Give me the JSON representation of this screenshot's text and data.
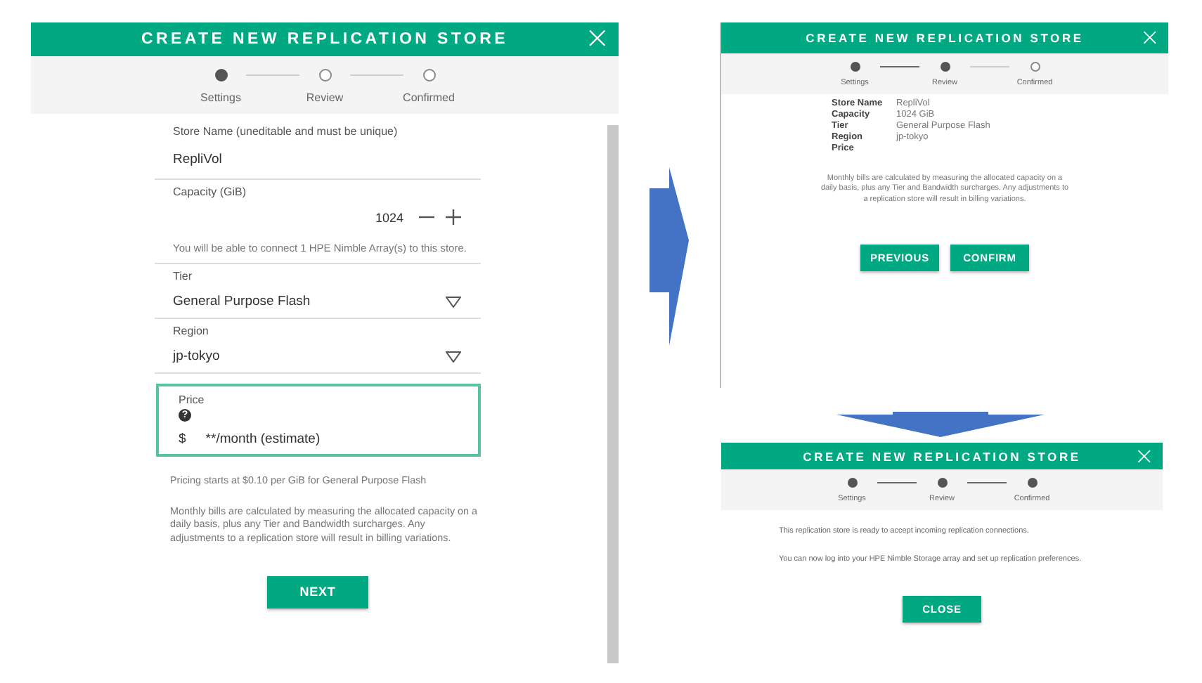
{
  "panels": [
    {
      "kind": "settings",
      "title": "CREATE NEW REPLICATION STORE",
      "close": "×",
      "steps": [
        {
          "label": "Settings",
          "completed": true
        },
        {
          "label": "Review",
          "completed": false
        },
        {
          "label": "Confirmed",
          "completed": false
        }
      ],
      "fields": [
        {
          "kind": "text",
          "label": "Store Name (uneditable and must be unique)",
          "value": "RepliVol"
        },
        {
          "kind": "stepper",
          "label": "Capacity (GiB)",
          "value": "1024",
          "note": "You will be able to connect 1 HPE Nimble Array(s) to this store."
        },
        {
          "kind": "select",
          "label": "Tier",
          "value": "General Purpose Flash"
        },
        {
          "kind": "select",
          "label": "Region",
          "value": "jp-tokyo"
        },
        {
          "kind": "price",
          "label": "Price",
          "help": "?",
          "currency": "$",
          "value": "**/month (estimate)"
        }
      ],
      "notes": [
        "Pricing starts at $0.10 per GiB for General Purpose Flash",
        "Monthly bills are calculated by measuring the allocated capacity on a daily basis, plus any Tier and Bandwidth surcharges. Any adjustments to a replication store will result in billing variations."
      ],
      "buttons": [
        "NEXT"
      ]
    },
    {
      "kind": "review",
      "title": "CREATE NEW REPLICATION STORE",
      "close": "×",
      "steps": [
        {
          "label": "Settings",
          "completed": true
        },
        {
          "label": "Review",
          "completed": true
        },
        {
          "label": "Confirmed",
          "completed": false
        }
      ],
      "summary": [
        {
          "label": "Store Name",
          "value": "RepliVol"
        },
        {
          "label": "Capacity",
          "value": "1024 GiB"
        },
        {
          "label": "Tier",
          "value": "General Purpose Flash"
        },
        {
          "label": "Region",
          "value": "jp-tokyo"
        },
        {
          "label": "Price"
        }
      ],
      "notes": [
        "Monthly bills are calculated by measuring the allocated capacity on a daily basis, plus any Tier and Bandwidth surcharges. Any adjustments to a replication store will result in billing variations."
      ],
      "buttons": [
        "PREVIOUS",
        "CONFIRM"
      ]
    },
    {
      "kind": "confirmed",
      "title": "CREATE NEW REPLICATION STORE",
      "close": "×",
      "steps": [
        {
          "label": "Settings",
          "completed": true
        },
        {
          "label": "Review",
          "completed": true
        },
        {
          "label": "Confirmed",
          "completed": true
        }
      ],
      "notes": [
        "This replication store is ready to accept incoming replication connections.",
        "You can now log into your HPE Nimble Storage array and set up replication preferences."
      ],
      "buttons": [
        "CLOSE"
      ]
    }
  ]
}
